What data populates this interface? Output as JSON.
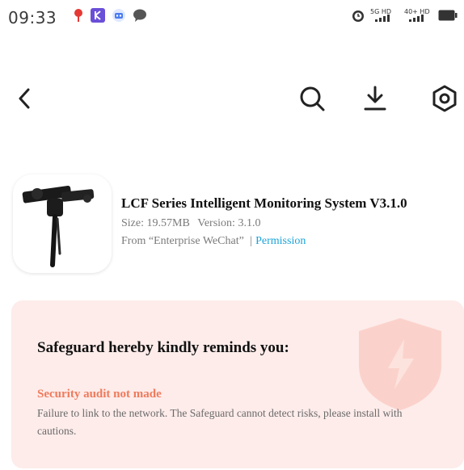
{
  "status_bar": {
    "time": "09:33",
    "left_icons": [
      "location-pin-icon",
      "kuaishou-app-icon",
      "bot-app-icon",
      "chat-bubble-icon"
    ],
    "right_icons": [
      "alarm-icon",
      "signal-5g-icon",
      "signal-4g-icon",
      "battery-icon"
    ],
    "net_1": "5G HD",
    "net_2": "40+ HD"
  },
  "toolbar": {
    "back": "back-arrow-icon",
    "search": "search-icon",
    "download": "download-icon",
    "settings": "settings-gear-icon"
  },
  "app": {
    "title": "LCF Series Intelligent Monitoring System V3.1.0",
    "size_text": "Size: 19.57MB",
    "version_text": "Version: 3.1.0",
    "source_text": "From “Enterprise WeChat”",
    "separator": "|",
    "permission_link": "Permission"
  },
  "notice": {
    "heading": "Safeguard hereby kindly reminds you:",
    "alert_title": "Security audit not made",
    "alert_body": "Failure to link to the network. The Safeguard cannot detect risks, please install with cautions."
  },
  "colors": {
    "link": "#1aa3d9",
    "alert": "#f07a5c",
    "notice_bg": "#fdecea"
  }
}
